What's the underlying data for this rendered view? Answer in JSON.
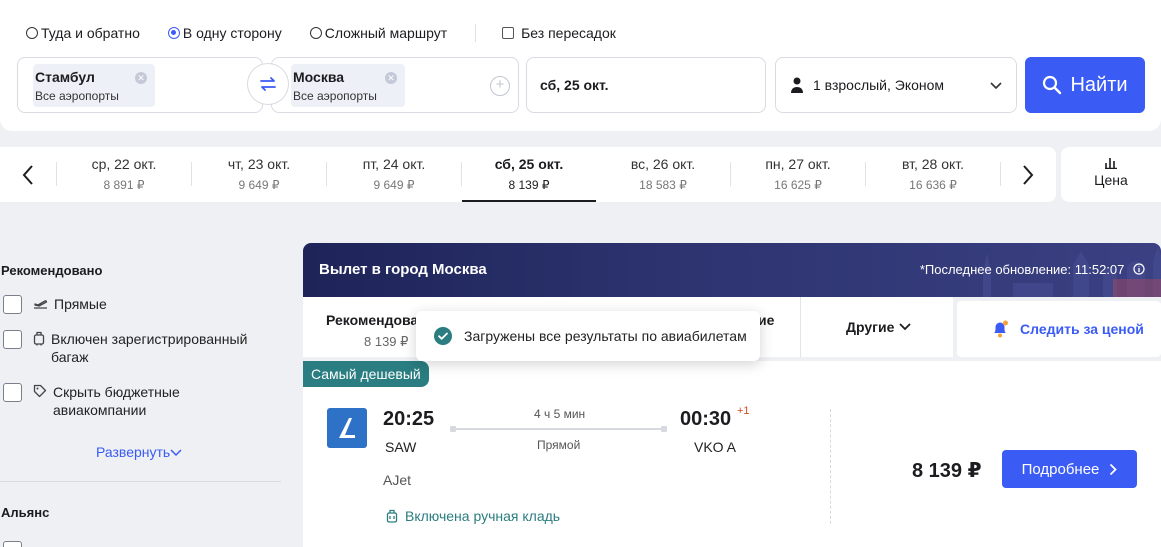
{
  "search": {
    "trip_types": [
      {
        "label": "Туда и обратно",
        "checked": false
      },
      {
        "label": "В одну сторону",
        "checked": true
      },
      {
        "label": "Сложный маршрут",
        "checked": false
      }
    ],
    "nonstop_label": "Без пересадок",
    "from": {
      "city": "Стамбул",
      "airports": "Все аэропорты"
    },
    "to": {
      "city": "Москва",
      "airports": "Все аэропорты"
    },
    "date": "сб, 25 окт.",
    "passengers": "1 взрослый, Эконом",
    "find_label": "Найти",
    "accent_color": "#3a5bf4"
  },
  "date_strip": {
    "days": [
      {
        "date": "ср, 22 окт.",
        "price": "8 891 ₽",
        "active": false
      },
      {
        "date": "чт, 23 окт.",
        "price": "9 649 ₽",
        "active": false
      },
      {
        "date": "пт, 24 окт.",
        "price": "9 649 ₽",
        "active": false
      },
      {
        "date": "сб, 25 окт.",
        "price": "8 139 ₽",
        "active": true
      },
      {
        "date": "вс, 26 окт.",
        "price": "18 583 ₽",
        "active": false
      },
      {
        "date": "пн, 27 окт.",
        "price": "16 625 ₽",
        "active": false
      },
      {
        "date": "вт, 28 окт.",
        "price": "16 636 ₽",
        "active": false
      }
    ],
    "price_tab_label": "Цена"
  },
  "sidebar": {
    "recommended_title": "Рекомендовано",
    "filters": [
      {
        "label": "Прямые",
        "icon": "plane-takeoff-icon"
      },
      {
        "label": "Включен зарегистрированный багаж",
        "icon": "suitcase-icon"
      },
      {
        "label": "Скрыть бюджетные авиакомпании",
        "icon": "tag-icon"
      }
    ],
    "expand_label": "Развернуть",
    "alliance_title": "Альянс"
  },
  "results": {
    "banner_title": "Вылет в город Москва",
    "updated": "*Последнее обновление: 11:52:07",
    "sort": {
      "recommended_label": "Рекомендовано",
      "recommended_price": "8 139 ₽",
      "fast_fragment": "ие",
      "other_label": "Другие"
    },
    "watch_price_label": "Следить за ценой",
    "toast": "Загружены все результаты по авиабилетам",
    "flight": {
      "badge": "Самый дешевый",
      "depart_time": "20:25",
      "depart_code": "SAW",
      "arrive_time": "00:30",
      "arrive_plus": "+1",
      "arrive_code": "VKO A",
      "duration": "4 ч 5 мин",
      "stops": "Прямой",
      "airline": "AJet",
      "baggage": "Включена ручная кладь",
      "price": "8 139 ₽",
      "details_label": "Подробнее"
    }
  }
}
